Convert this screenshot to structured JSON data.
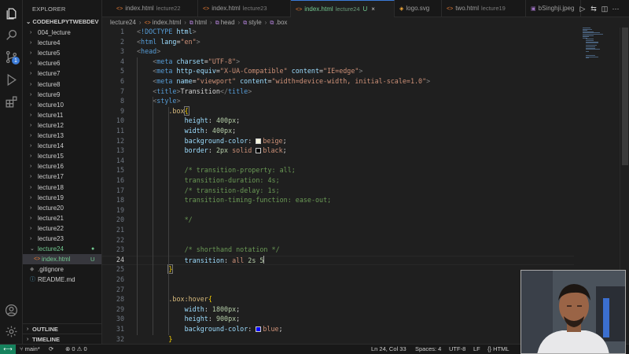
{
  "sidebar": {
    "title": "EXPLORER",
    "root": "CODEHELPYTWEBDEV",
    "items": [
      {
        "label": "004_lecture",
        "type": "folder",
        "expanded": false
      },
      {
        "label": "lecture4",
        "type": "folder",
        "expanded": false
      },
      {
        "label": "lecture5",
        "type": "folder",
        "expanded": false
      },
      {
        "label": "lecture6",
        "type": "folder",
        "expanded": false
      },
      {
        "label": "lecture7",
        "type": "folder",
        "expanded": false
      },
      {
        "label": "lecture8",
        "type": "folder",
        "expanded": false
      },
      {
        "label": "lecture9",
        "type": "folder",
        "expanded": false
      },
      {
        "label": "lecture10",
        "type": "folder",
        "expanded": false
      },
      {
        "label": "lecture11",
        "type": "folder",
        "expanded": false
      },
      {
        "label": "lecture12",
        "type": "folder",
        "expanded": false
      },
      {
        "label": "lecture13",
        "type": "folder",
        "expanded": false
      },
      {
        "label": "lecture14",
        "type": "folder",
        "expanded": false
      },
      {
        "label": "lecture15",
        "type": "folder",
        "expanded": false
      },
      {
        "label": "lecture16",
        "type": "folder",
        "expanded": false
      },
      {
        "label": "lecture17",
        "type": "folder",
        "expanded": false
      },
      {
        "label": "lecture18",
        "type": "folder",
        "expanded": false
      },
      {
        "label": "lecture19",
        "type": "folder",
        "expanded": false
      },
      {
        "label": "lecture20",
        "type": "folder",
        "expanded": false
      },
      {
        "label": "lecture21",
        "type": "folder",
        "expanded": false
      },
      {
        "label": "lecture22",
        "type": "folder",
        "expanded": false
      },
      {
        "label": "lecture23",
        "type": "folder",
        "expanded": false
      },
      {
        "label": "lecture24",
        "type": "folder",
        "expanded": true
      },
      {
        "label": "index.html",
        "type": "file",
        "status": "U"
      },
      {
        "label": ".gitignore",
        "type": "file"
      },
      {
        "label": "README.md",
        "type": "file"
      }
    ],
    "outline_label": "OUTLINE",
    "timeline_label": "TIMELINE"
  },
  "activity": {
    "icons": [
      "explorer-icon",
      "search-icon",
      "source-control-icon",
      "run-debug-icon",
      "extensions-icon",
      "account-icon",
      "settings-gear-icon"
    ],
    "source_control_badge": "1"
  },
  "tabs": [
    {
      "name": "index.html",
      "sub": "lecture22",
      "active": false
    },
    {
      "name": "index.html",
      "sub": "lecture23",
      "active": false
    },
    {
      "name": "index.html",
      "sub": "lecture24",
      "active": true,
      "status": "U",
      "close": "×"
    },
    {
      "name": "logo.svg",
      "sub": "",
      "active": false
    },
    {
      "name": "two.html",
      "sub": "lecture19",
      "active": false
    },
    {
      "name": "bSinghji.jpeg",
      "sub": "",
      "active": false
    }
  ],
  "breadcrumb": [
    "lecture24",
    "index.html",
    "html",
    "head",
    "style",
    ".box"
  ],
  "editor": {
    "current_line": 24,
    "lines": [
      {
        "n": 1,
        "indent": 0,
        "tokens": [
          [
            "t-punc",
            "<"
          ],
          [
            "t-doc",
            "!DOCTYPE "
          ],
          [
            "t-attr",
            "html"
          ],
          [
            "t-punc",
            ">"
          ]
        ]
      },
      {
        "n": 2,
        "indent": 0,
        "tokens": [
          [
            "t-punc",
            "<"
          ],
          [
            "t-tag",
            "html "
          ],
          [
            "t-attr",
            "lang"
          ],
          [
            "t-txt",
            "="
          ],
          [
            "t-str",
            "\"en\""
          ],
          [
            "t-punc",
            ">"
          ]
        ]
      },
      {
        "n": 3,
        "indent": 0,
        "tokens": [
          [
            "t-punc",
            "<"
          ],
          [
            "t-tag",
            "head"
          ],
          [
            "t-punc",
            ">"
          ]
        ]
      },
      {
        "n": 4,
        "indent": 1,
        "tokens": [
          [
            "t-punc",
            "<"
          ],
          [
            "t-tag",
            "meta "
          ],
          [
            "t-attr",
            "charset"
          ],
          [
            "t-txt",
            "="
          ],
          [
            "t-str",
            "\"UTF-8\""
          ],
          [
            "t-punc",
            ">"
          ]
        ]
      },
      {
        "n": 5,
        "indent": 1,
        "tokens": [
          [
            "t-punc",
            "<"
          ],
          [
            "t-tag",
            "meta "
          ],
          [
            "t-attr",
            "http-equiv"
          ],
          [
            "t-txt",
            "="
          ],
          [
            "t-str",
            "\"X-UA-Compatible\""
          ],
          [
            "t-txt",
            " "
          ],
          [
            "t-attr",
            "content"
          ],
          [
            "t-txt",
            "="
          ],
          [
            "t-str",
            "\"IE=edge\""
          ],
          [
            "t-punc",
            ">"
          ]
        ]
      },
      {
        "n": 6,
        "indent": 1,
        "tokens": [
          [
            "t-punc",
            "<"
          ],
          [
            "t-tag",
            "meta "
          ],
          [
            "t-attr",
            "name"
          ],
          [
            "t-txt",
            "="
          ],
          [
            "t-str",
            "\"viewport\""
          ],
          [
            "t-txt",
            " "
          ],
          [
            "t-attr",
            "content"
          ],
          [
            "t-txt",
            "="
          ],
          [
            "t-str",
            "\"width=device-width, initial-scale=1.0\""
          ],
          [
            "t-punc",
            ">"
          ]
        ]
      },
      {
        "n": 7,
        "indent": 1,
        "tokens": [
          [
            "t-punc",
            "<"
          ],
          [
            "t-tag",
            "title"
          ],
          [
            "t-punc",
            ">"
          ],
          [
            "t-txt",
            "Transition"
          ],
          [
            "t-punc",
            "</"
          ],
          [
            "t-tag",
            "title"
          ],
          [
            "t-punc",
            ">"
          ]
        ]
      },
      {
        "n": 8,
        "indent": 1,
        "tokens": [
          [
            "t-punc",
            "<"
          ],
          [
            "t-tag",
            "style"
          ],
          [
            "t-punc",
            ">"
          ]
        ]
      },
      {
        "n": 9,
        "indent": 2,
        "tokens": [
          [
            "t-sel",
            ".box"
          ],
          [
            "t-brace1 brk",
            "{"
          ]
        ]
      },
      {
        "n": 10,
        "indent": 3,
        "tokens": [
          [
            "t-prop",
            "height"
          ],
          [
            "t-txt",
            ": "
          ],
          [
            "t-num",
            "400px"
          ],
          [
            "t-txt",
            ";"
          ]
        ]
      },
      {
        "n": 11,
        "indent": 3,
        "tokens": [
          [
            "t-prop",
            "width"
          ],
          [
            "t-txt",
            ": "
          ],
          [
            "t-num",
            "400px"
          ],
          [
            "t-txt",
            ";"
          ]
        ]
      },
      {
        "n": 12,
        "indent": 3,
        "tokens": [
          [
            "t-prop",
            "background-color"
          ],
          [
            "t-txt",
            ": "
          ],
          [
            "swatch",
            "#f5f5dc"
          ],
          [
            "t-val",
            "beige"
          ],
          [
            "t-txt",
            ";"
          ]
        ]
      },
      {
        "n": 13,
        "indent": 3,
        "tokens": [
          [
            "t-prop",
            "border"
          ],
          [
            "t-txt",
            ": "
          ],
          [
            "t-num",
            "2px"
          ],
          [
            "t-txt",
            " "
          ],
          [
            "t-val",
            "solid "
          ],
          [
            "swatch",
            "#000000"
          ],
          [
            "t-val",
            "black"
          ],
          [
            "t-txt",
            ";"
          ]
        ]
      },
      {
        "n": 14,
        "indent": 0,
        "tokens": []
      },
      {
        "n": 15,
        "indent": 3,
        "tokens": [
          [
            "t-com",
            "/* transition-property: all;"
          ]
        ]
      },
      {
        "n": 16,
        "indent": 3,
        "tokens": [
          [
            "t-com",
            "transition-duration: 4s;"
          ]
        ]
      },
      {
        "n": 17,
        "indent": 3,
        "tokens": [
          [
            "t-com",
            "/* transition-delay: 1s;"
          ]
        ]
      },
      {
        "n": 18,
        "indent": 3,
        "tokens": [
          [
            "t-com",
            "transition-timing-function: ease-out;"
          ]
        ]
      },
      {
        "n": 19,
        "indent": 0,
        "tokens": []
      },
      {
        "n": 20,
        "indent": 3,
        "tokens": [
          [
            "t-com",
            "*/"
          ]
        ]
      },
      {
        "n": 21,
        "indent": 0,
        "tokens": []
      },
      {
        "n": 22,
        "indent": 0,
        "tokens": []
      },
      {
        "n": 23,
        "indent": 3,
        "tokens": [
          [
            "t-com",
            "/* shorthand notation */"
          ]
        ]
      },
      {
        "n": 24,
        "indent": 3,
        "tokens": [
          [
            "t-prop",
            "transition"
          ],
          [
            "t-txt",
            ": "
          ],
          [
            "t-val",
            "all "
          ],
          [
            "t-num",
            "2s"
          ],
          [
            "t-txt",
            " "
          ],
          [
            "t-num",
            "5"
          ],
          [
            "caret",
            ""
          ]
        ]
      },
      {
        "n": 25,
        "indent": 2,
        "tokens": [
          [
            "t-brace1 brk",
            "}"
          ]
        ]
      },
      {
        "n": 26,
        "indent": 0,
        "tokens": []
      },
      {
        "n": 27,
        "indent": 0,
        "tokens": []
      },
      {
        "n": 28,
        "indent": 2,
        "tokens": [
          [
            "t-sel",
            ".box"
          ],
          [
            "t-sel",
            ":hover"
          ],
          [
            "t-brace1",
            "{"
          ]
        ]
      },
      {
        "n": 29,
        "indent": 3,
        "tokens": [
          [
            "t-prop",
            "width"
          ],
          [
            "t-txt",
            ": "
          ],
          [
            "t-num",
            "1800px"
          ],
          [
            "t-txt",
            ";"
          ]
        ]
      },
      {
        "n": 30,
        "indent": 3,
        "tokens": [
          [
            "t-prop",
            "height"
          ],
          [
            "t-txt",
            ": "
          ],
          [
            "t-num",
            "900px"
          ],
          [
            "t-txt",
            ";"
          ]
        ]
      },
      {
        "n": 31,
        "indent": 3,
        "tokens": [
          [
            "t-prop",
            "background-color"
          ],
          [
            "t-txt",
            ": "
          ],
          [
            "swatch",
            "#0000ff"
          ],
          [
            "t-val",
            "blue"
          ],
          [
            "t-txt",
            ";"
          ]
        ]
      },
      {
        "n": 32,
        "indent": 2,
        "tokens": [
          [
            "t-brace1",
            "}"
          ]
        ]
      }
    ]
  },
  "status": {
    "branch": "main*",
    "errors": "0",
    "warnings": "0",
    "position": "Ln 24, Col 33",
    "spaces": "Spaces: 4",
    "encoding": "UTF-8",
    "eol": "LF",
    "language": "HTML"
  },
  "colors": {
    "accent": "#3b7bd8",
    "remote": "#16825d",
    "untracked": "#73c991",
    "html_icon": "#e37933"
  }
}
